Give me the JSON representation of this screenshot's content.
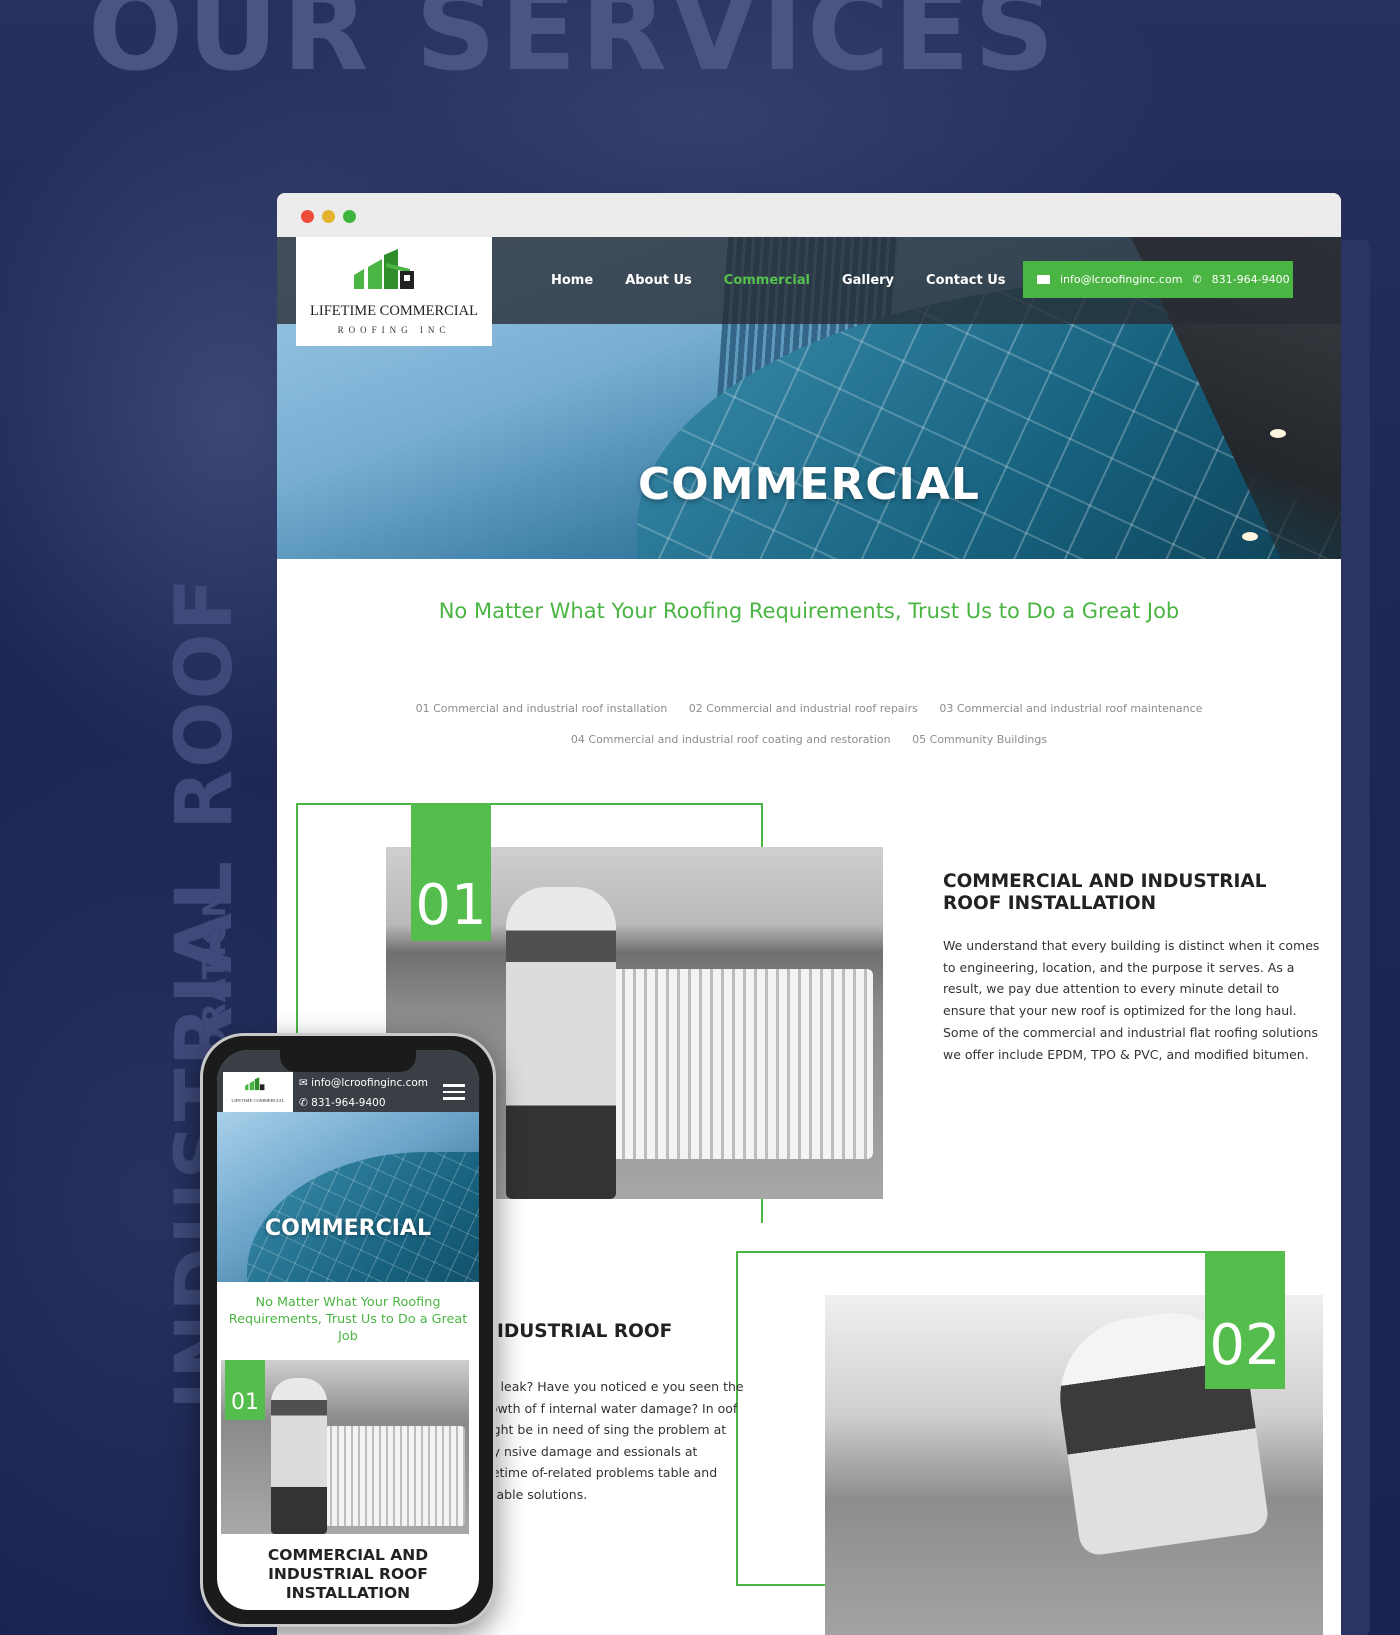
{
  "showcase": {
    "title": "OUR SERVICES",
    "vertical_title": "INDUSTRIAL ROOF",
    "vertical_subtitle": "COATING AND RESTORATION"
  },
  "brand": {
    "name": "LIFETIME COMMERCIAL",
    "sub": "ROOFING INC",
    "green": "#4bb543",
    "dark": "#1b2450"
  },
  "nav": {
    "items": [
      {
        "label": "Home",
        "active": false
      },
      {
        "label": "About Us",
        "active": false
      },
      {
        "label": "Commercial",
        "active": true
      },
      {
        "label": "Gallery",
        "active": false
      },
      {
        "label": "Contact Us",
        "active": false
      }
    ]
  },
  "contact": {
    "email": "info@lcroofinginc.com",
    "phone": "831-964-9400",
    "mail_icon": "mail-icon",
    "phone_icon": "phone-icon"
  },
  "hero": {
    "title": "COMMERCIAL"
  },
  "tagline": "No Matter What Your Roofing Requirements, Trust Us to Do a Great Job",
  "service_links": [
    "01 Commercial and industrial roof installation",
    "02 Commercial and industrial roof repairs",
    "03 Commercial and industrial roof maintenance",
    "04 Commercial and industrial roof coating and restoration",
    "05 Community Buildings"
  ],
  "sections": [
    {
      "number": "01",
      "title": "COMMERCIAL AND INDUSTRIAL ROOF INSTALLATION",
      "body": "We understand that every building is distinct when it comes to engineering, location, and the purpose it serves. As a result, we pay due attention to every minute detail to ensure that your new roof is optimized for the long haul. Some of the commercial and industrial flat roofing solutions we offer include EPDM, TPO & PVC, and modified bitumen."
    },
    {
      "number": "02",
      "title": "IDUSTRIAL ROOF",
      "body": "g a leak? Have you noticed e you seen the growth of f internal water damage? In oof might be in need of sing the problem at any nsive damage and essionals at Lifetime of-related problems table and reliable solutions."
    }
  ],
  "mobile": {
    "email": "info@lcroofinginc.com",
    "phone": "831-964-9400",
    "logo_name": "LIFETIME COMMERCIAL",
    "hero_title": "COMMERCIAL",
    "tagline": "No Matter What Your Roofing Requirements, Trust Us to Do a Great Job",
    "badge": "01",
    "section_title": "COMMERCIAL AND INDUSTRIAL ROOF INSTALLATION",
    "menu_icon": "hamburger-menu-icon"
  }
}
